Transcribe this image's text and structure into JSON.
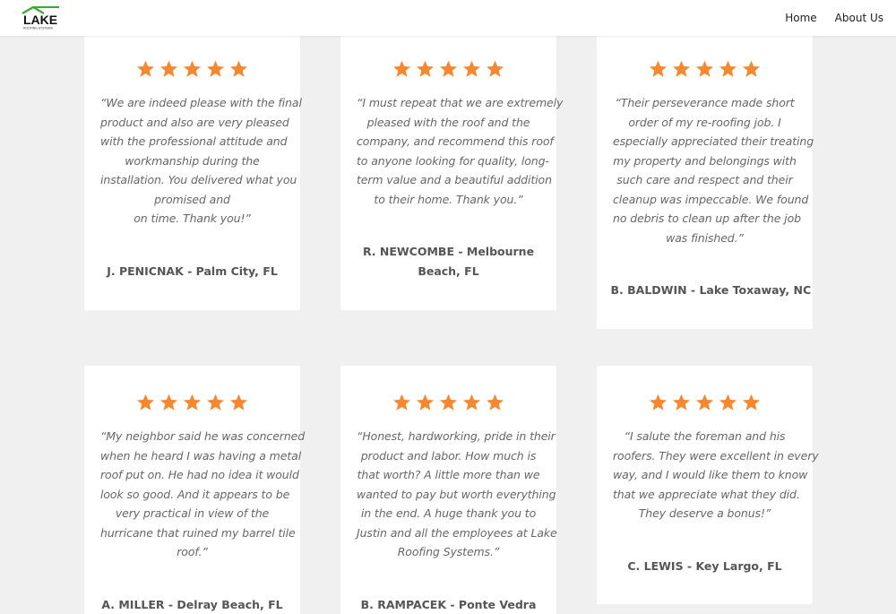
{
  "header": {
    "logo": {
      "brand": "LAKE",
      "tagline": "ROOFING SYSTEMS",
      "icon": "roof-icon",
      "accent": "#3aaa35"
    },
    "nav": {
      "home": "Home",
      "about": "About Us"
    }
  },
  "star_color": "#f7882f",
  "rating_per_review": 5,
  "testimonials": [
    {
      "rating": 5,
      "quote_lines": [
        "“We are indeed please with the final",
        "product and also are very pleased",
        "with the professional attitude and",
        "workmanship during the",
        "installation. You delivered what you",
        "promised and",
        "on time. Thank you!”"
      ],
      "author_lines": [
        "J. PENICNAK - Palm City, FL"
      ]
    },
    {
      "rating": 5,
      "quote_lines": [
        "“I must repeat that we are extremely",
        "pleased with the roof and the",
        "company, and recommend this roof",
        "to anyone looking for quality, long-",
        "term value and a beautiful addition",
        "to their home. Thank you.”"
      ],
      "author_lines": [
        "R. NEWCOMBE - Melbourne",
        "Beach, FL"
      ]
    },
    {
      "rating": 5,
      "quote_lines": [
        "“Their perseverance made short",
        "order of my re-roofing job. I",
        "especially appreciated their treating",
        "my property and belongings with",
        "such care and respect and their",
        "cleanup was impeccable. We found",
        "no debris to clean up after the job",
        "was finished.”"
      ],
      "author_lines": [
        "B. BALDWIN - Lake Toxaway, NC"
      ]
    },
    {
      "rating": 5,
      "quote_lines": [
        "“My neighbor said he was concerned",
        "when he heard I was having a metal",
        "roof put on. He had no idea it would",
        "look so good. And it appears to be",
        "very practical in view of the",
        "hurricane that ruined my barrel tile",
        "roof.”"
      ],
      "author_lines": [
        "A. MILLER - Delray Beach, FL"
      ]
    },
    {
      "rating": 5,
      "quote_lines": [
        "“Honest, hardworking, pride in their",
        "product and labor. How much is",
        "that worth? A little more than we",
        "wanted to pay but worth everything",
        "in the end. A huge thank you to",
        "Justin and all the employees at Lake",
        "Roofing Systems.”"
      ],
      "author_lines": [
        "B. RAMPACEK - Ponte Vedra"
      ]
    },
    {
      "rating": 5,
      "quote_lines": [
        "“I salute the foreman and his",
        "roofers. They were excellent in every",
        "way, and  I would like them to know",
        "that we appreciate what they did.",
        "They deserve a bonus!”"
      ],
      "author_lines": [
        "C. LEWIS - Key Largo, FL"
      ]
    }
  ]
}
